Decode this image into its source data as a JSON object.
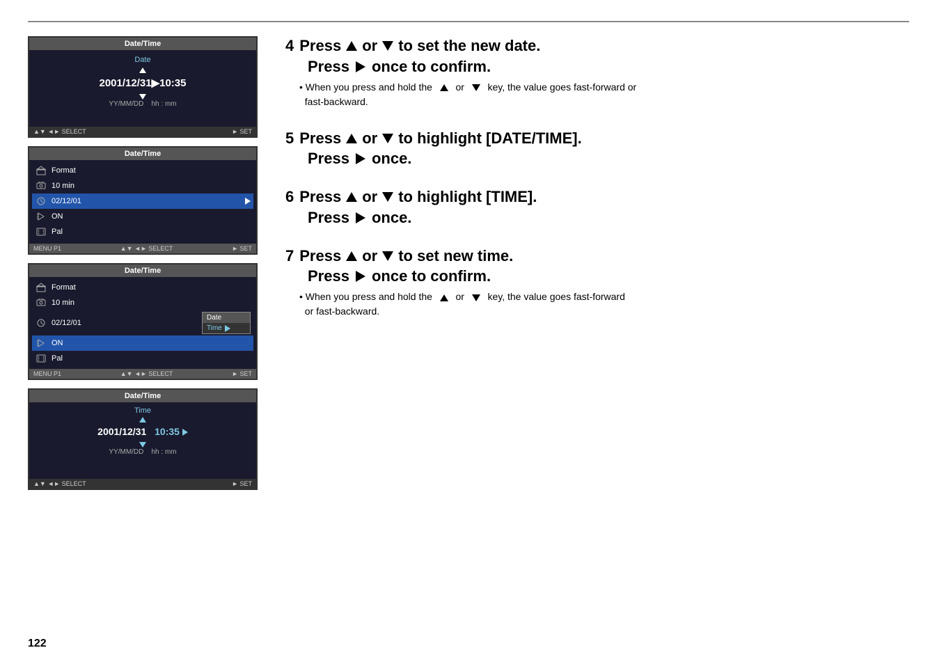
{
  "page": {
    "number": "122",
    "top_line": true
  },
  "screens": {
    "screen1": {
      "title": "Date/Time",
      "subtitle": "Date",
      "date_value": "2001/12/31",
      "separator": "▶",
      "time_value": "10:35",
      "format_label": "YY/MM/DD",
      "time_format": "hh : mm",
      "bottom_left": "▲▼ ◄► SELECT",
      "bottom_right": "► SET"
    },
    "screen2": {
      "title": "Date/Time",
      "bottom_left_label": "MENU P1",
      "bottom_mid_label": "▲▼ ◄► SELECT",
      "bottom_right_label": "► SET",
      "rows": [
        {
          "icon": "house",
          "label": "Format",
          "value": ""
        },
        {
          "icon": "cam",
          "label": "",
          "value": "10 min"
        },
        {
          "icon": "clock",
          "label": "",
          "value": "02/12/01",
          "has_arrow": true
        },
        {
          "icon": "speaker",
          "label": "",
          "value": "ON"
        },
        {
          "icon": "film",
          "label": "",
          "value": "Pal"
        }
      ]
    },
    "screen3": {
      "title": "Date/Time",
      "bottom_left_label": "MENU P1",
      "bottom_mid_label": "▲▼ ◄► SELECT",
      "bottom_right_label": "► SET",
      "rows": [
        {
          "icon": "house",
          "label": "Format",
          "value": ""
        },
        {
          "icon": "cam",
          "label": "",
          "value": "10 min"
        },
        {
          "icon": "clock",
          "label": "",
          "value": "02/12/01"
        },
        {
          "icon": "speaker",
          "label": "",
          "value": "ON"
        },
        {
          "icon": "film",
          "label": "",
          "value": "Pal"
        }
      ],
      "submenu": {
        "items": [
          "Date",
          "Time"
        ],
        "active_index": 1
      }
    },
    "screen4": {
      "title": "Date/Time",
      "subtitle": "Time",
      "date_value": "2001/12/31",
      "time_value": "10:35",
      "time_arrow": "▶",
      "format_label": "YY/MM/DD",
      "time_format": "hh : mm",
      "bottom_left": "▲▼ ◄► SELECT",
      "bottom_right": "► SET"
    }
  },
  "steps": {
    "step4": {
      "number": "4",
      "line1_parts": [
        "Press",
        "or",
        "to set the new date."
      ],
      "line2_parts": [
        "Press",
        "once to confirm."
      ],
      "bullet": "When you press and hold the     ▲   or   ▼   key, the value goes fast-forward or fast-backward."
    },
    "step5": {
      "number": "5",
      "line1_parts": [
        "Press",
        "or",
        "to highlight [DATE/TIME]."
      ],
      "line2_parts": [
        "Press",
        "once."
      ]
    },
    "step6": {
      "number": "6",
      "line1_parts": [
        "Press",
        "or",
        "to highlight [TIME]."
      ],
      "line2_parts": [
        "Press",
        "once."
      ]
    },
    "step7": {
      "number": "7",
      "line1_parts": [
        "Press",
        "or",
        "to set new time."
      ],
      "line2_parts": [
        "Press",
        "once to confirm."
      ],
      "bullet": "When you press and hold the    ▲   or   ▼   key, the value goes fast-forward or fast-backward."
    }
  }
}
